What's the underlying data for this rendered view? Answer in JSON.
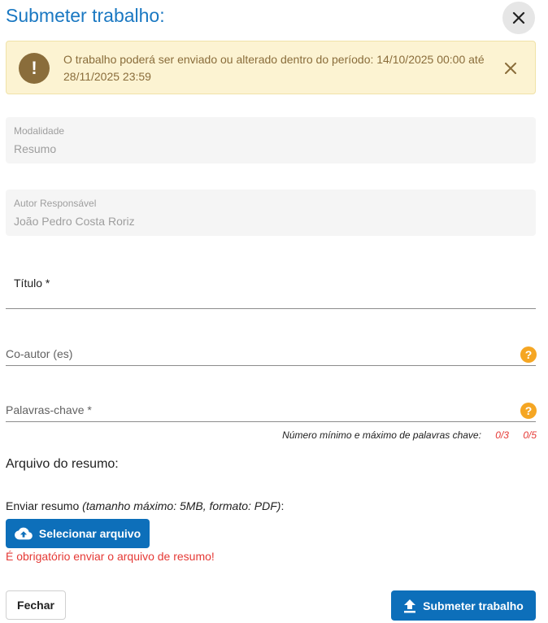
{
  "dialog": {
    "title": "Submeter trabalho:",
    "close_icon": "close-icon"
  },
  "alert": {
    "icon": "exclamation-icon",
    "message": "O trabalho poderá ser enviado ou alterado dentro do período: 14/10/2025 00:00 até 28/11/2025 23:59",
    "dismiss_icon": "close-icon"
  },
  "fields": {
    "modalidade": {
      "label": "Modalidade",
      "value": "Resumo"
    },
    "autor": {
      "label": "Autor Responsável",
      "value": "João Pedro Costa Roriz"
    },
    "titulo": {
      "label": "Título *",
      "value": ""
    },
    "coautor": {
      "label": "Co-autor (es)",
      "value": "",
      "help_icon": "question-icon"
    },
    "palavras": {
      "label": "Palavras-chave *",
      "value": "",
      "help_icon": "question-icon"
    }
  },
  "keywords_hint": {
    "text": "Número mínimo e máximo de palavras chave:",
    "min_count": "0/3",
    "max_count": "0/5"
  },
  "upload": {
    "section_title": "Arquivo do resumo:",
    "desc_prefix": "Enviar resumo ",
    "desc_detail": "(tamanho máximo: 5MB, formato: PDF)",
    "desc_suffix": ":",
    "button_label": "Selecionar arquivo",
    "button_icon": "cloud-upload-icon",
    "error": "É obrigatório enviar o arquivo de resumo!"
  },
  "footer": {
    "close_label": "Fechar",
    "submit_label": "Submeter trabalho",
    "submit_icon": "upload-icon"
  },
  "colors": {
    "accent": "#1a78c2",
    "button_primary": "#0d6fba",
    "alert_bg": "#fcf3d2",
    "alert_text": "#8a6d3b",
    "help": "#f5a623",
    "error": "#e53935"
  }
}
